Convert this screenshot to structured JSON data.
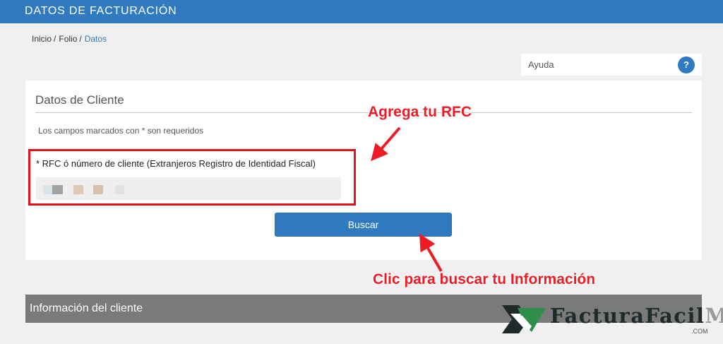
{
  "header": {
    "title": "DATOS DE FACTURACIÓN"
  },
  "breadcrumb": [
    {
      "label": "Inicio",
      "sep": "/"
    },
    {
      "label": "Folio",
      "sep": "/"
    },
    {
      "label": "Datos"
    }
  ],
  "help": {
    "label": "Ayuda",
    "icon": "question-icon",
    "icon_glyph": "?"
  },
  "form": {
    "heading": "Datos de Cliente",
    "required_note": "Los campos marcados con * son requeridos",
    "rfc_label": "* RFC ó número de cliente (Extranjeros Registro de Identidad Fiscal)",
    "rfc_value_obscured": true,
    "search_button": "Buscar"
  },
  "annotations": {
    "rfc_hint": "Agrega tu RFC",
    "search_hint": "Clic para buscar tu Información",
    "color": "#ee1b24"
  },
  "info_section": {
    "title": "Información del cliente"
  },
  "watermark": {
    "brand": "FacturaFacil",
    "brand_suffix": "MX",
    "domain": ".COM"
  },
  "colors": {
    "primary": "#2f7ac0",
    "info_bar": "#7a7a7a",
    "highlight_border": "#e8111a"
  }
}
